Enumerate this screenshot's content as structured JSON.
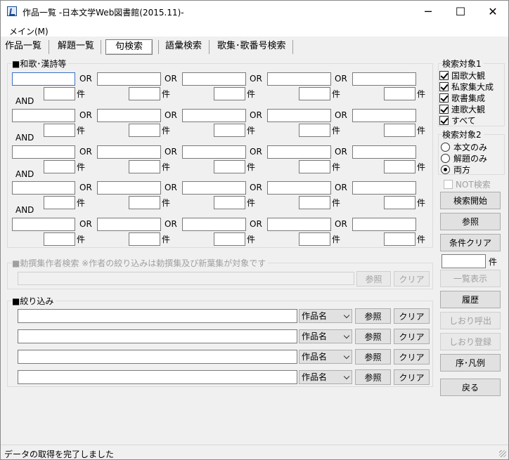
{
  "window": {
    "title": "作品一覧 -日本文学Web図書館(2015.11)-",
    "minimize": "─",
    "maximize": "☐",
    "close": "✕"
  },
  "menu": {
    "main": "メイン(M)"
  },
  "tabs": [
    "作品一覧",
    "解題一覧",
    "句検索",
    "語彙検索",
    "歌集･歌番号検索"
  ],
  "search": {
    "title": "■和歌･漢詩等",
    "or_label": "OR",
    "and_label": "AND",
    "count_label": "件"
  },
  "author_search": {
    "title": "■勅撰集作者検索 ※作者の絞り込みは勅撰集及び新葉集が対象です",
    "ref": "参照",
    "clear": "クリア"
  },
  "filter": {
    "title": "■絞り込み",
    "rows": [
      {
        "combo": "作品名",
        "ref": "参照",
        "clear": "クリア"
      },
      {
        "combo": "作品名",
        "ref": "参照",
        "clear": "クリア"
      },
      {
        "combo": "作品名",
        "ref": "参照",
        "clear": "クリア"
      },
      {
        "combo": "作品名",
        "ref": "参照",
        "clear": "クリア"
      }
    ]
  },
  "target1": {
    "title": "検索対象1",
    "items": [
      "国歌大観",
      "私家集大成",
      "歌書集成",
      "連歌大観",
      "すべて"
    ]
  },
  "target2": {
    "title": "検索対象2",
    "items": [
      "本文のみ",
      "解題のみ",
      "両方"
    ],
    "selected": "両方"
  },
  "not_search": "NOT検索",
  "buttons": {
    "start": "検索開始",
    "ref": "参照",
    "clear_cond": "条件クリア",
    "count_unit": "件",
    "list": "一覧表示",
    "history": "履歴",
    "bookmark_load": "しおり呼出",
    "bookmark_save": "しおり登録",
    "legend": "序･凡例",
    "back": "戻る"
  },
  "status": "データの取得を完了しました"
}
